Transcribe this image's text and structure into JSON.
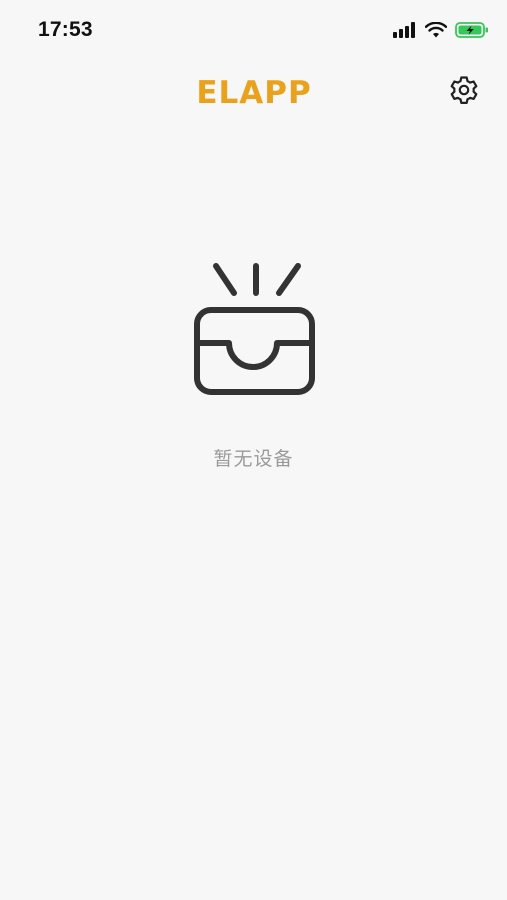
{
  "status_bar": {
    "time": "17:53",
    "icons": [
      "cellular-signal-icon",
      "wifi-icon",
      "battery-charging-icon"
    ]
  },
  "header": {
    "logo_text": "ELAPP",
    "logo_color": "#E8A21E",
    "settings_icon": "gear-icon"
  },
  "empty_state": {
    "icon": "empty-inbox-icon",
    "message": "暂无设备"
  },
  "colors": {
    "background": "#f7f7f7",
    "icon_stroke": "#333333",
    "muted_text": "#9a9a9a"
  }
}
